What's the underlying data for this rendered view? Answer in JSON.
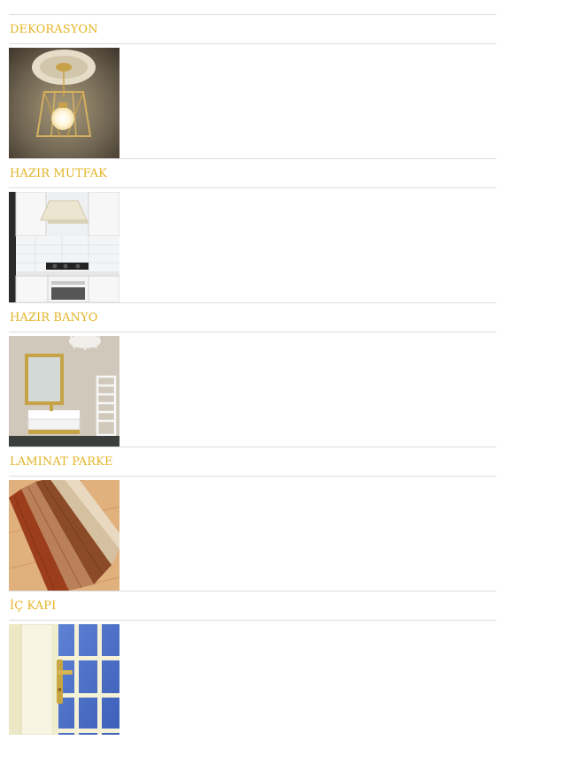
{
  "categories": [
    {
      "label": "DEKORASYON",
      "thumb": "pendant-lamp-image"
    },
    {
      "label": "HAZIR MUTFAK",
      "thumb": "kitchen-image"
    },
    {
      "label": "HAZIR BANYO",
      "thumb": "bathroom-image"
    },
    {
      "label": "LAMINAT PARKE",
      "thumb": "laminate-planks-image"
    },
    {
      "label": "İÇ KAPI",
      "thumb": "interior-door-image"
    }
  ],
  "colors": {
    "link": "#e3b424",
    "divider": "#dcdcdc"
  }
}
